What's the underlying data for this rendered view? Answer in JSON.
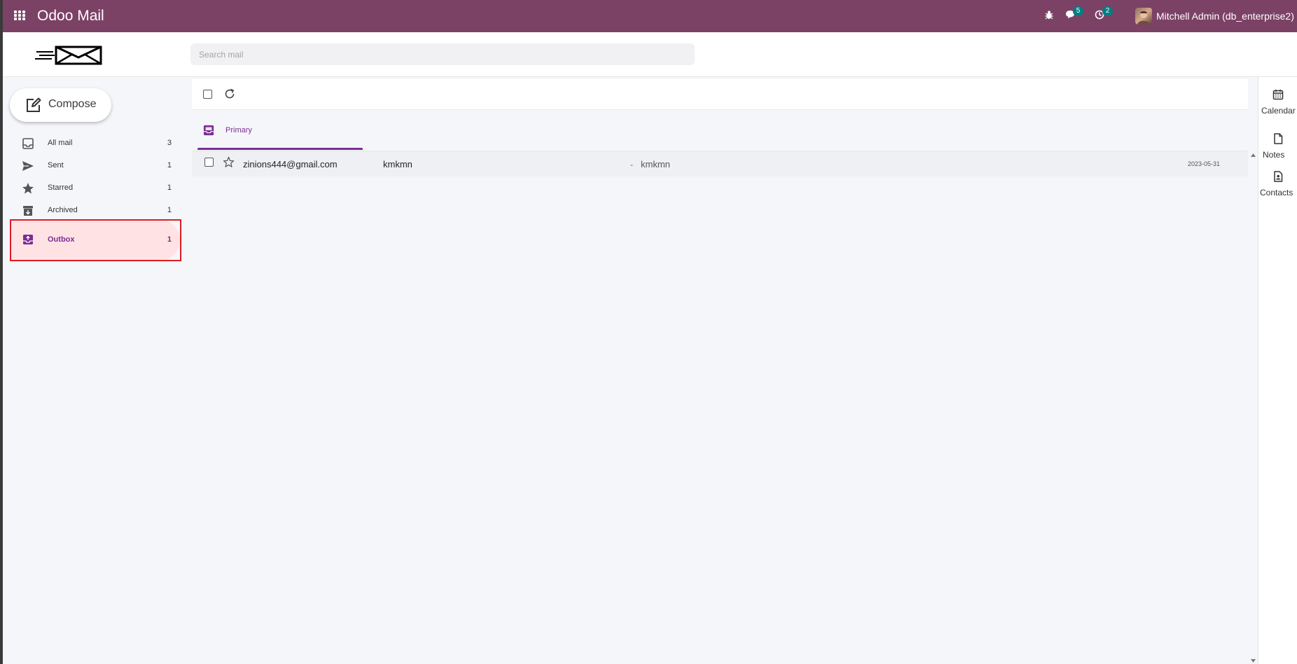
{
  "navbar": {
    "app_title": "Odoo Mail",
    "messages_badge": "5",
    "activities_badge": "2",
    "user": "Mitchell Admin (db_enterprise2)"
  },
  "search": {
    "placeholder": "Search mail"
  },
  "compose": {
    "label": "Compose"
  },
  "sidebar": {
    "items": [
      {
        "label": "All mail",
        "count": "3",
        "icon": "inbox-icon"
      },
      {
        "label": "Sent",
        "count": "1",
        "icon": "send-icon"
      },
      {
        "label": "Starred",
        "count": "1",
        "icon": "star-icon"
      },
      {
        "label": "Archived",
        "count": "1",
        "icon": "archive-icon"
      },
      {
        "label": "Outbox",
        "count": "1",
        "icon": "outbox-icon",
        "active": true
      }
    ]
  },
  "tabs": {
    "primary": "Primary"
  },
  "messages": [
    {
      "from": "zinions444@gmail.com",
      "subject": "kmkmn",
      "separator": "-",
      "snippet": "kmkmn",
      "date": "2023-05-31"
    }
  ],
  "right_rail": {
    "calendar": "Calendar",
    "notes": "Notes",
    "contacts": "Contacts"
  },
  "colors": {
    "navbar": "#7c4266",
    "accent": "#7c2d92",
    "active_bg": "#ffe3e4",
    "badge": "#017e84",
    "highlight_border": "#e01b24"
  }
}
